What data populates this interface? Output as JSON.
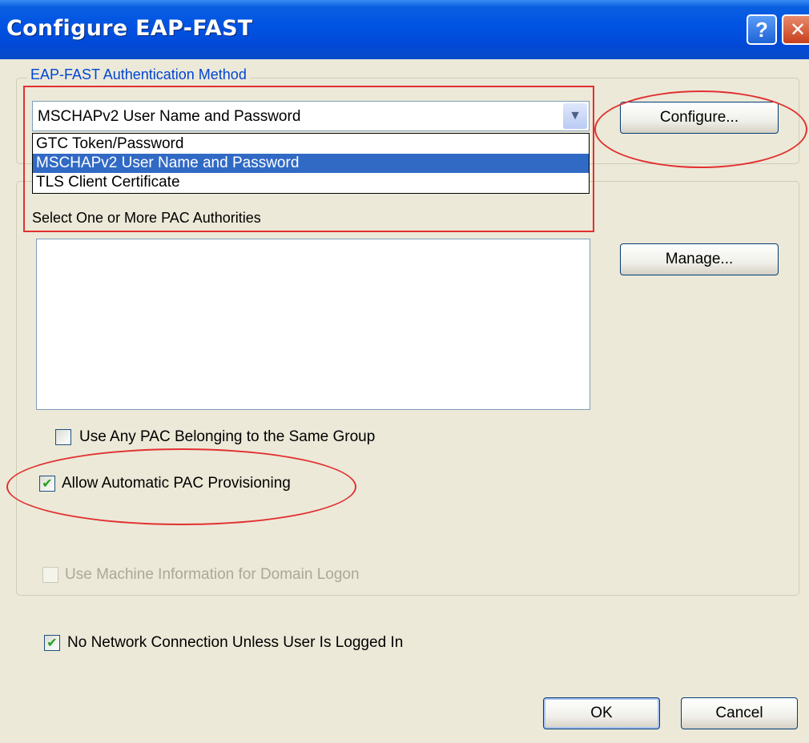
{
  "window": {
    "title": "Configure EAP-FAST",
    "help_glyph": "?",
    "close_glyph": "✕"
  },
  "auth_method": {
    "group_label": "EAP-FAST Authentication Method",
    "selected_value": "MSCHAPv2 User Name and Password",
    "options": [
      {
        "label": "GTC Token/Password",
        "selected": false
      },
      {
        "label": "MSCHAPv2 User Name and Password",
        "selected": true
      },
      {
        "label": "TLS Client Certificate",
        "selected": false
      }
    ],
    "configure_label": "Configure..."
  },
  "pac": {
    "authorities_label": "Select One or More PAC Authorities",
    "manage_label": "Manage..."
  },
  "options": {
    "use_any_pac": {
      "label": "Use Any PAC Belonging to the Same Group",
      "checked": false
    },
    "allow_auto_pac": {
      "label": "Allow Automatic PAC Provisioning",
      "checked": true
    },
    "use_machine_info": {
      "label": "Use Machine Information for Domain Logon",
      "checked": false,
      "enabled": false
    },
    "no_network_unless_logged": {
      "label": "No Network Connection Unless User Is Logged In",
      "checked": true
    }
  },
  "buttons": {
    "ok_label": "OK",
    "cancel_label": "Cancel"
  },
  "colors": {
    "title_blue": "#0054e3",
    "selection": "#316ac5",
    "annotation_red": "#e23030",
    "group_label": "#0046d5"
  }
}
